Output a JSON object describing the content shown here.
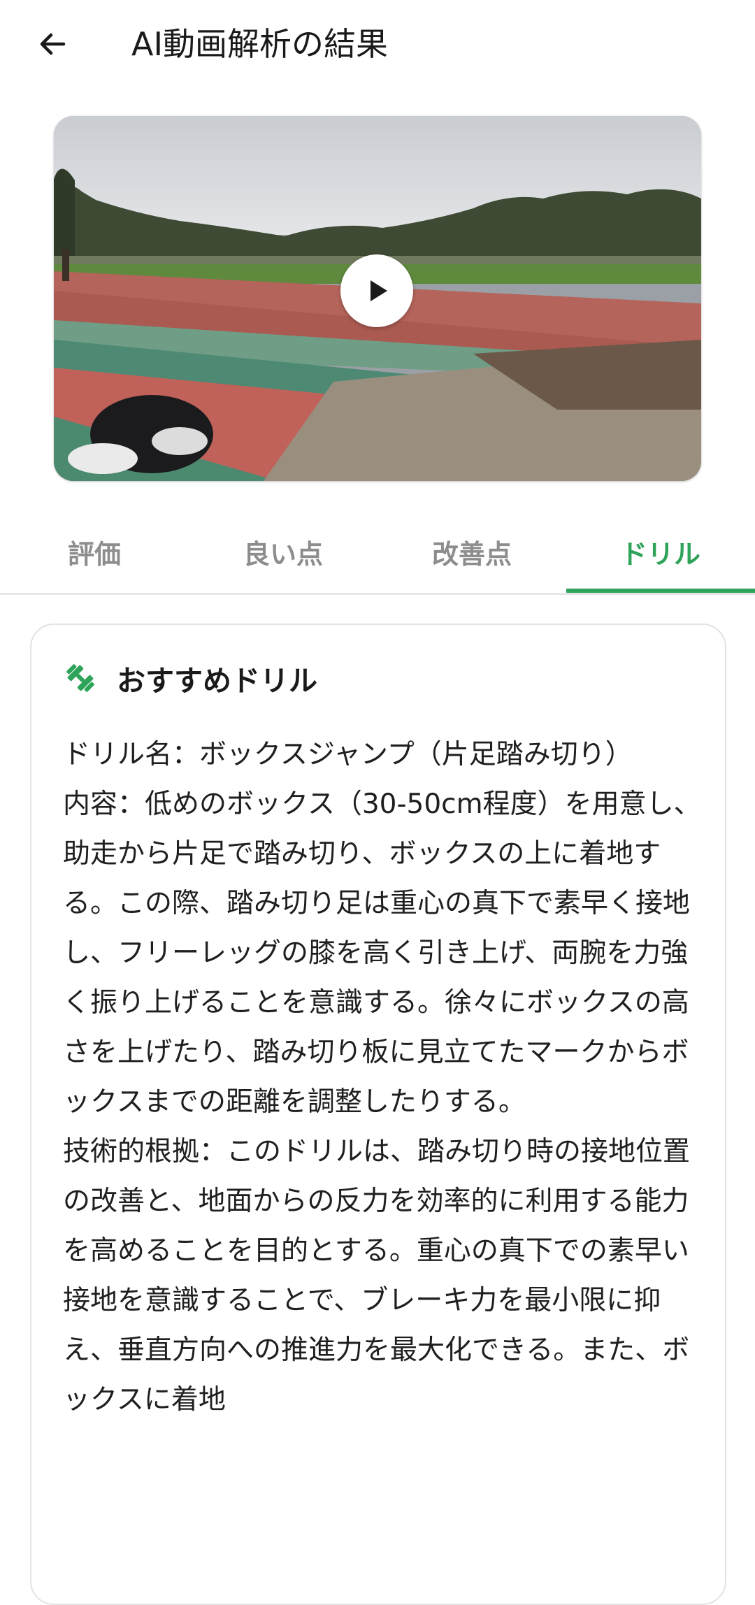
{
  "header": {
    "title": "AI動画解析の結果",
    "back_icon": "arrow-left-icon"
  },
  "video": {
    "play_icon": "play-icon"
  },
  "tabs": [
    {
      "label": "評価",
      "active": false
    },
    {
      "label": "良い点",
      "active": false
    },
    {
      "label": "改善点",
      "active": false
    },
    {
      "label": "ドリル",
      "active": true
    }
  ],
  "card": {
    "icon": "dumbbell-icon",
    "title": "おすすめドリル",
    "paragraphs": [
      "ドリル名：ボックスジャンプ（片足踏み切り）",
      "内容：低めのボックス（30-50cm程度）を用意し、助走から片足で踏み切り、ボックスの上に着地する。この際、踏み切り足は重心の真下で素早く接地し、フリーレッグの膝を高く引き上げ、両腕を力強く振り上げることを意識する。徐々にボックスの高さを上げたり、踏み切り板に見立てたマークからボックスまでの距離を調整したりする。",
      "技術的根拠：このドリルは、踏み切り時の接地位置の改善と、地面からの反力を効率的に利用する能力を高めることを目的とする。重心の真下での素早い接地を意識することで、ブレーキ力を最小限に抑え、垂直方向への推進力を最大化できる。また、ボックスに着地"
    ]
  },
  "colors": {
    "accent": "#2ea35a",
    "tab_inactive": "#8d8d8d",
    "divider": "#e6e6e6"
  }
}
